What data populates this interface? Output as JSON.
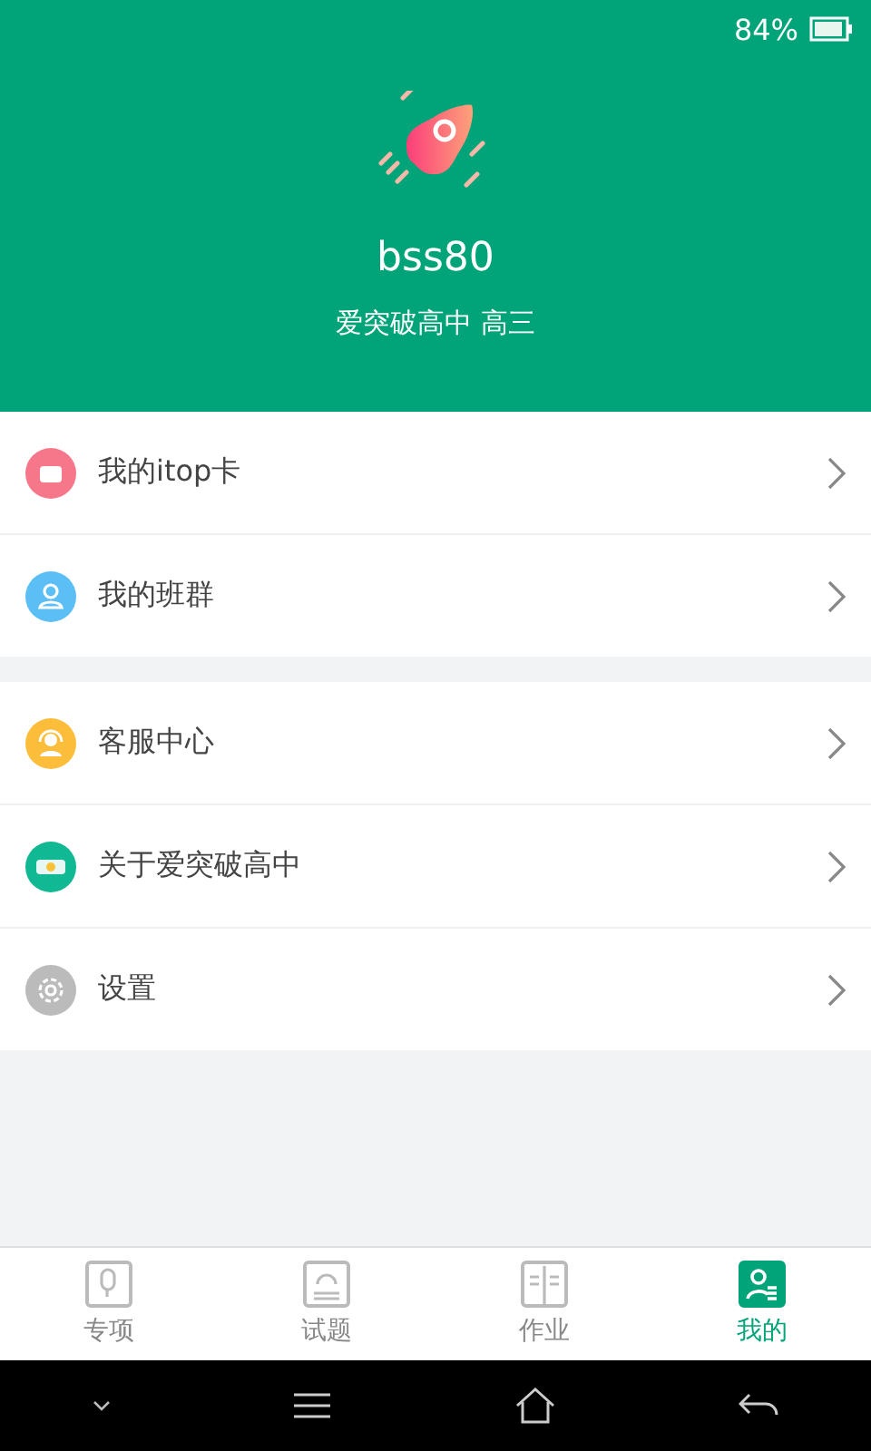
{
  "status_bar": {
    "battery": "84%"
  },
  "profile": {
    "name": "bss80",
    "school": "爱突破高中 高三"
  },
  "menu_groups": [
    [
      {
        "kind": "wallet",
        "label": "我的itop卡"
      },
      {
        "kind": "group",
        "label": "我的班群"
      }
    ],
    [
      {
        "kind": "service",
        "label": "客服中心"
      },
      {
        "kind": "about",
        "label": "关于爱突破高中"
      },
      {
        "kind": "settings",
        "label": "设置"
      }
    ]
  ],
  "tabs": [
    {
      "kind": "mic",
      "label": "专项",
      "selected": false
    },
    {
      "kind": "exam",
      "label": "试题",
      "selected": false
    },
    {
      "kind": "book",
      "label": "作业",
      "selected": false
    },
    {
      "kind": "user",
      "label": "我的",
      "selected": true
    }
  ]
}
